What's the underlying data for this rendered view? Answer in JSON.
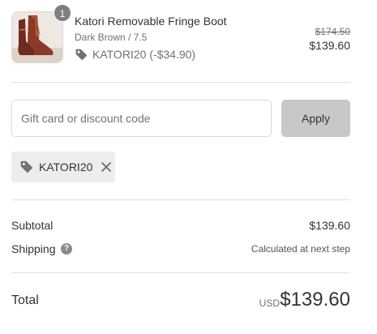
{
  "product": {
    "name": "Katori Removable Fringe Boot",
    "variant": "Dark Brown / 7.5",
    "quantity": "1",
    "discount_text": "KATORI20 (-$34.90)",
    "original_price": "$174.50",
    "price": "$139.60"
  },
  "discount_form": {
    "placeholder": "Gift card or discount code",
    "value": "",
    "apply_label": "Apply"
  },
  "applied_code": {
    "label": "KATORI20"
  },
  "summary": {
    "subtotal_label": "Subtotal",
    "subtotal_value": "$139.60",
    "shipping_label": "Shipping",
    "shipping_help": "?",
    "shipping_value": "Calculated at next step",
    "total_label": "Total",
    "total_currency": "USD",
    "total_value": "$139.60"
  },
  "colors": {
    "badge": "#7f7f7f",
    "apply_button": "#c8c8c8",
    "chip_background": "#ededed",
    "boot": "#8a3a26"
  },
  "icons": {
    "tag": "tag-icon",
    "close": "close-icon",
    "help": "question-circle-icon"
  }
}
